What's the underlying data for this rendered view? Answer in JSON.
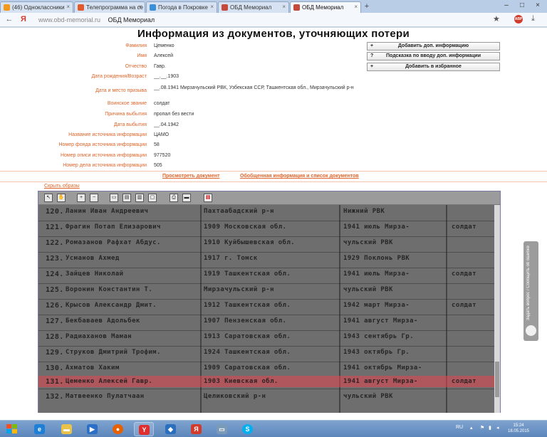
{
  "browser": {
    "tabs": [
      {
        "label": "(46) Одноклассники",
        "color": "#f39a1e"
      },
      {
        "label": "Телепрограмма на се",
        "color": "#e05a2b"
      },
      {
        "label": "Погода в Покровке",
        "color": "#3a8fd9"
      },
      {
        "label": "ОБД Мемориал",
        "color": "#c64a3a"
      },
      {
        "label": "ОБД Мемориал",
        "color": "#c64a3a"
      }
    ],
    "new_tab": "+",
    "url_host": "www.obd-memorial.ru",
    "url_title": "ОБД Мемориал",
    "ext_badge": "ABP"
  },
  "page": {
    "title": "Информация из документов, уточняющих потери",
    "fields": [
      {
        "label": "Фамилия",
        "value": "Цеменко"
      },
      {
        "label": "Имя",
        "value": "Алексей"
      },
      {
        "label": "Отчество",
        "value": "Гавр."
      },
      {
        "label": "Дата рождения/Возраст",
        "value": "__.__.1903"
      },
      {
        "label": "Дата и место призыва",
        "value": "__.08.1941 Мирзачульский РВК, Узбекская ССР, Ташкентская обл., Мирзачульский р-н"
      },
      {
        "label": "Воинское звание",
        "value": "солдат"
      },
      {
        "label": "Причина выбытия",
        "value": "пропал без вести"
      },
      {
        "label": "Дата выбытия",
        "value": "__.04.1942"
      },
      {
        "label": "Название источника информации",
        "value": "ЦАМО"
      },
      {
        "label": "Номер фонда источника информации",
        "value": "58"
      },
      {
        "label": "Номер описи источника информации",
        "value": "977520"
      },
      {
        "label": "Номер дела источника информации",
        "value": "505"
      }
    ],
    "side_buttons": [
      {
        "icon": "+",
        "label": "Добавить доп. информацию"
      },
      {
        "icon": "?",
        "label": "Подсказка по вводу доп. информации"
      },
      {
        "icon": "+",
        "label": "Добавить в избранное"
      }
    ],
    "links": {
      "view_document": "Просмотреть документ",
      "general_info": "Обобщенная информация и список документов"
    },
    "hide_images": "Скрыть образы"
  },
  "scan_rows": [
    {
      "num": "120.",
      "name": "Ланин Иван Андреевич",
      "origin": "Пахтаабадский р-н",
      "conscription": "Нижний РВК"
    },
    {
      "num": "121.",
      "name": "Фрагин Потап Елизарович",
      "origin": "1909 Московская обл.",
      "conscription": "1941 июль Мирза-"
    },
    {
      "num": "122.",
      "name": "Ромазанов Рафхат Абдус.",
      "origin": "1910 Куйбышевская обл.",
      "conscription": "чульский РВК"
    },
    {
      "num": "123.",
      "name": "Усманов Ахмед",
      "origin": "1917 г. Томск",
      "conscription": "1929 Поклонь РВК"
    },
    {
      "num": "124.",
      "name": "Зайцев Николай",
      "origin": "1919 Ташкентская обл.",
      "conscription": "1941 июль Мирза-"
    },
    {
      "num": "125.",
      "name": "Воронин Константин Т.",
      "origin": "Мирзачульский р-н",
      "conscription": "чульский РВК"
    },
    {
      "num": "126.",
      "name": "Крысов Александр Дмит.",
      "origin": "1912 Ташкентская обл.",
      "conscription": "1942 март Мирза-"
    },
    {
      "num": "127.",
      "name": "Бекбаваев Адольбек",
      "origin": "1907 Пензенская обл.",
      "conscription": "1941 август Мирза-"
    },
    {
      "num": "128.",
      "name": "Радиаханов Маман",
      "origin": "1913 Саратовская обл.",
      "conscription": "1943 сентябрь Гр."
    },
    {
      "num": "129.",
      "name": "Струков Дмитрий Трофим.",
      "origin": "1924 Ташкентская обл.",
      "conscription": "1943 октябрь Гр."
    },
    {
      "num": "130.",
      "name": "Ахматов Хаким",
      "origin": "1909 Саратовская обл.",
      "conscription": "1941 октябрь Мирза-"
    },
    {
      "num": "131.",
      "name": "Цеменко Алексей Гавр.",
      "origin": "1903 Киевская обл.",
      "conscription": "1941 август Мирза-"
    },
    {
      "num": "132.",
      "name": "Матвеенко Пулатчаан",
      "origin": "Целиковский р-н",
      "conscription": "чульский РВК"
    }
  ],
  "scan_rank": "солдат",
  "feedback_tab": "Задать вопрос / Сообщить об ошибке",
  "taskbar": {
    "lang": "RU",
    "time": "15:24",
    "date": "18.05.2015"
  }
}
